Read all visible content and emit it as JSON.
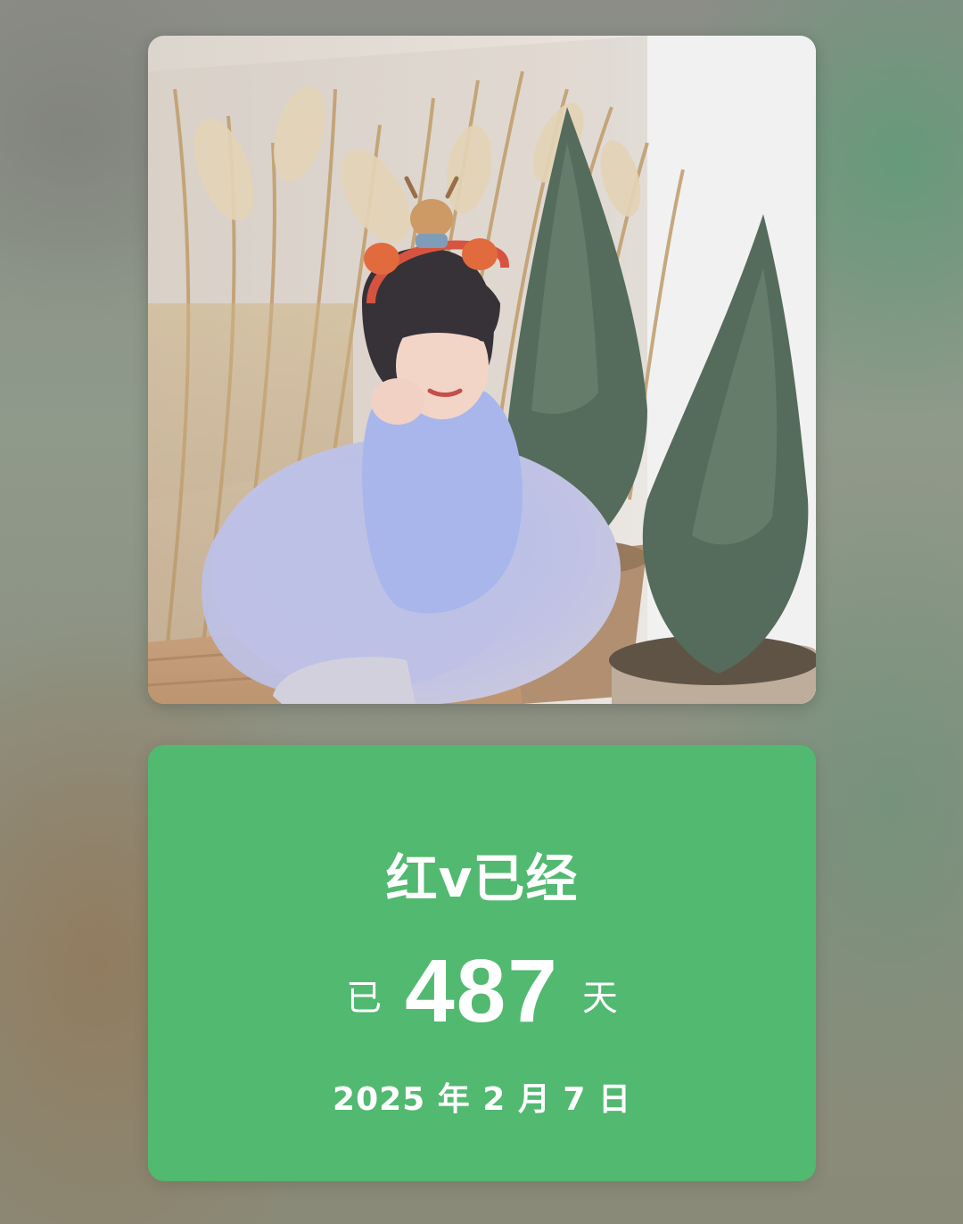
{
  "counter": {
    "title": "红v已经",
    "prefix": "已",
    "days": "487",
    "suffix": "天",
    "date": "2025 年 2 月 7 日"
  },
  "colors": {
    "card_green": "#52b970",
    "text": "#ffffff"
  }
}
